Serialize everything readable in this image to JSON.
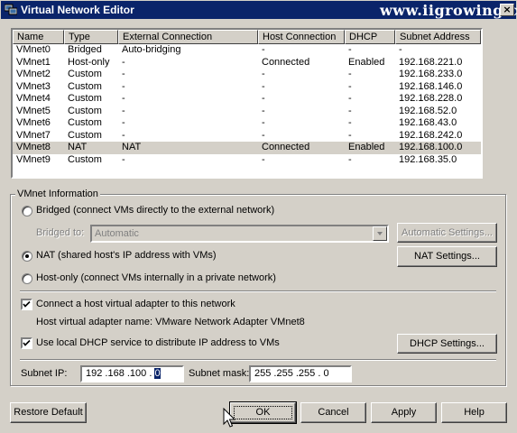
{
  "window": {
    "title": "Virtual Network Editor",
    "close_glyph": "×"
  },
  "watermark": "www.iigrowing.cn",
  "table": {
    "columns": [
      "Name",
      "Type",
      "External Connection",
      "Host Connection",
      "DHCP",
      "Subnet Address"
    ],
    "rows": [
      [
        "VMnet0",
        "Bridged",
        "Auto-bridging",
        "-",
        "-",
        "-"
      ],
      [
        "VMnet1",
        "Host-only",
        "-",
        "Connected",
        "Enabled",
        "192.168.221.0"
      ],
      [
        "VMnet2",
        "Custom",
        "-",
        "-",
        "-",
        "192.168.233.0"
      ],
      [
        "VMnet3",
        "Custom",
        "-",
        "-",
        "-",
        "192.168.146.0"
      ],
      [
        "VMnet4",
        "Custom",
        "-",
        "-",
        "-",
        "192.168.228.0"
      ],
      [
        "VMnet5",
        "Custom",
        "-",
        "-",
        "-",
        "192.168.52.0"
      ],
      [
        "VMnet6",
        "Custom",
        "-",
        "-",
        "-",
        "192.168.43.0"
      ],
      [
        "VMnet7",
        "Custom",
        "-",
        "-",
        "-",
        "192.168.242.0"
      ],
      [
        "VMnet8",
        "NAT",
        "NAT",
        "Connected",
        "Enabled",
        "192.168.100.0"
      ],
      [
        "VMnet9",
        "Custom",
        "-",
        "-",
        "-",
        "192.168.35.0"
      ]
    ],
    "selected_row": "VMnet8"
  },
  "vmnet_info": {
    "legend": "VMnet Information",
    "bridged_label": "Bridged (connect VMs directly to the external network)",
    "bridged_to_label": "Bridged to:",
    "bridged_to_value": "Automatic",
    "auto_settings_button": "Automatic Settings...",
    "nat_label": "NAT (shared host's IP address with VMs)",
    "nat_settings_button": "NAT Settings...",
    "hostonly_label": "Host-only (connect VMs internally in a private network)",
    "connect_adapter_label": "Connect a host virtual adapter to this network",
    "adapter_name_label": "Host virtual adapter name: VMware Network Adapter VMnet8",
    "dhcp_label": "Use local DHCP service to distribute IP address to VMs",
    "dhcp_settings_button": "DHCP Settings...",
    "subnet_ip_label": "Subnet IP:",
    "subnet_ip_value_prefix": "192 .168 .100 . ",
    "subnet_ip_value_selected": "0",
    "subnet_mask_label": "Subnet mask:",
    "subnet_mask_value": "255 .255 .255 .  0",
    "selected_mode": "NAT",
    "connect_adapter_checked": true,
    "dhcp_checked": true
  },
  "buttons": {
    "restore_default": "Restore Default",
    "ok": "OK",
    "cancel": "Cancel",
    "apply": "Apply",
    "help": "Help"
  },
  "colors": {
    "titlebar": "#0a246a",
    "face": "#d4d0c8",
    "selection": "#0a246a"
  }
}
